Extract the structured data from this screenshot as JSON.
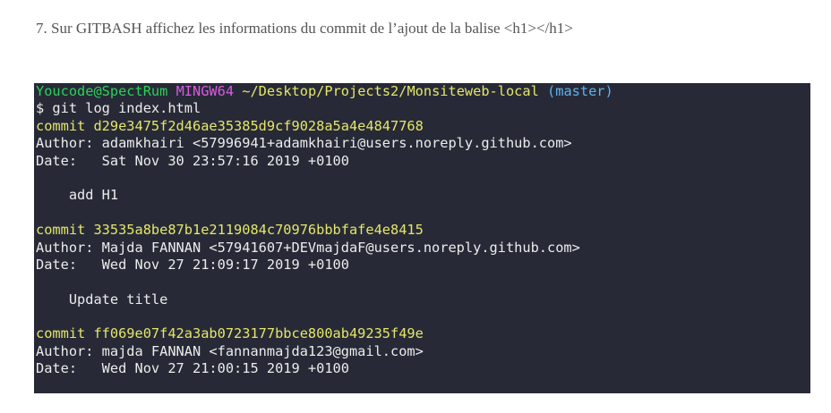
{
  "instruction": {
    "text": "7. Sur GITBASH affichez les informations du commit de l’ajout de la balise <h1></h1>"
  },
  "terminal": {
    "prompt": {
      "user_host": "Youcode@SpectRum",
      "env": "MINGW64",
      "path": "~/Desktop/Projects2/Monsiteweb-local",
      "branch": "(master)"
    },
    "command": "$ git log index.html",
    "commits": [
      {
        "commit_line": "commit d29e3475f2d46ae35385d9cf9028a5a4e4847768",
        "author_line": "Author: adamkhairi <57996941+adamkhairi@users.noreply.github.com>",
        "date_line": "Date:   Sat Nov 30 23:57:16 2019 +0100",
        "message_line": "    add H1"
      },
      {
        "commit_line": "commit 33535a8be87b1e2119084c70976bbbfafe4e8415",
        "author_line": "Author: Majda FANNAN <57941607+DEVmajdaF@users.noreply.github.com>",
        "date_line": "Date:   Wed Nov 27 21:09:17 2019 +0100",
        "message_line": "    Update title"
      },
      {
        "commit_line": "commit ff069e07f42a3ab0723177bbce800ab49235f49e",
        "author_line": "Author: majda FANNAN <fannanmajda123@gmail.com>",
        "date_line": "Date:   Wed Nov 27 21:00:15 2019 +0100",
        "message_line": ""
      }
    ]
  }
}
